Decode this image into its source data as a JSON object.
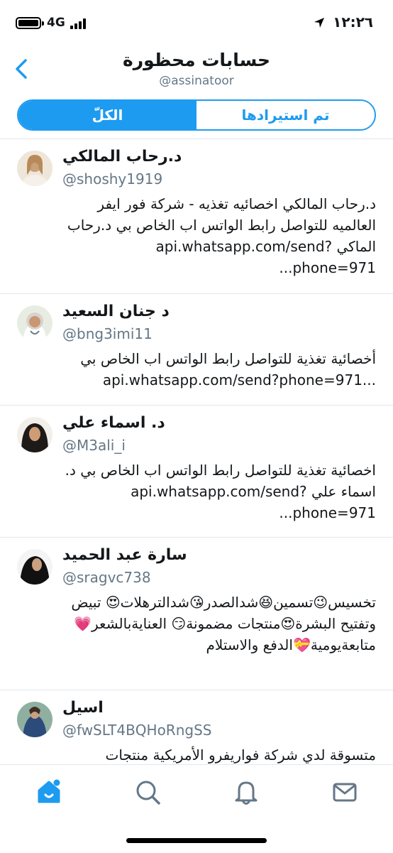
{
  "status_bar": {
    "network": "4G",
    "time": "١٢:٢٦"
  },
  "header": {
    "title": "حسابات محظورة",
    "subtitle": "@assinatoor"
  },
  "tabs": {
    "all": "الكلّ",
    "imported": "تم استيرادها"
  },
  "accounts": [
    {
      "name": "د.رحاب المالكي",
      "handle": "@shoshy1919",
      "bio": "د.رحاب المالكي اخصائيه تغذيه - شركة فور ايفر العالميه للتواصل رابط الواتس اب الخاص بي د.رحاب الماكي api.whatsapp.com/send?phone=971..."
    },
    {
      "name": "د جنان السعيد",
      "handle": "@bng3imi11",
      "bio": "أخصائية تغذية للتواصل رابط الواتس اب الخاص بي ...api.whatsapp.com/send?phone=971"
    },
    {
      "name": "د. اسماء علي",
      "handle": "@M3ali_i",
      "bio": "اخصائية تغذية للتواصل رابط الواتس اب الخاص بي د. اسماء علي api.whatsapp.com/send?phone=971..."
    },
    {
      "name": "سارة عبد الحميد",
      "handle": "@sragvc738",
      "bio": "تخسيس😉تسمين😆شدالصدر😘شدالترهلات😍 تبيض وتفتيح البشرة😍منتجات مضمونة😏 العنايةبالشعر💗متابعةيومية💝الدفع والاستلام"
    },
    {
      "name": "اسيل",
      "handle": "@fwSLT4BQHoRngSS",
      "bio": "متسوقة لدي شركة فواريفرو الأمريكية منتجات طبيعية آمنة وفعالة للتواصل"
    }
  ],
  "icons": {
    "back": "chevron-left-icon",
    "home": "home-icon",
    "search": "search-icon",
    "notifications": "bell-icon",
    "messages": "mail-icon"
  },
  "colors": {
    "accent": "#1d9bf0",
    "secondary_text": "#657786",
    "divider": "#e1e8ed"
  }
}
